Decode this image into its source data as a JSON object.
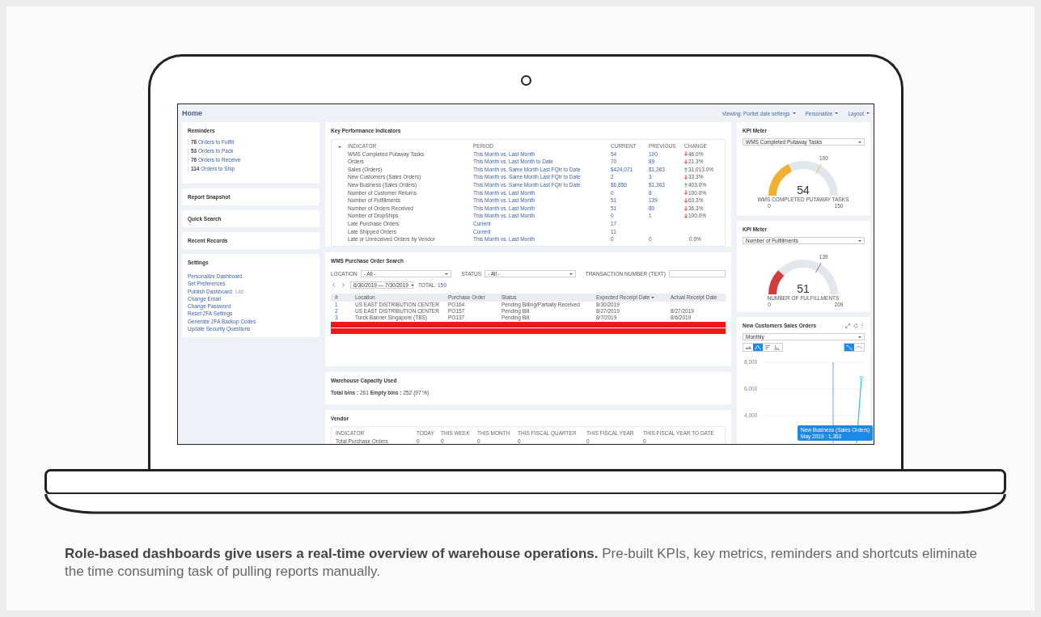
{
  "page": {
    "title": "Home",
    "header_links": [
      "Viewing: Portlet date settings",
      "Personalize",
      "Layout"
    ]
  },
  "reminders": {
    "title": "Reminders",
    "items": [
      {
        "count": "78",
        "label": "Orders to Fulfill"
      },
      {
        "count": "53",
        "label": "Orders to Pack"
      },
      {
        "count": "76",
        "label": "Orders to Receive"
      },
      {
        "count": "114",
        "label": "Orders to Ship"
      }
    ]
  },
  "collapsed_portlets": [
    "Report Snapshot",
    "Quick Search",
    "Recent Records"
  ],
  "settings": {
    "title": "Settings",
    "links": [
      {
        "label": "Personalize Dashboard"
      },
      {
        "label": "Set Preferences"
      },
      {
        "label": "Publish Dashboard",
        "badge": "List"
      },
      {
        "label": "Change Email"
      },
      {
        "label": "Change Password"
      },
      {
        "label": "Reset 2FA Settings"
      },
      {
        "label": "Generate 2FA Backup Codes"
      },
      {
        "label": "Update Security Questions"
      }
    ]
  },
  "kpi": {
    "title": "Key Performance Indicators",
    "columns": [
      "INDICATOR",
      "PERIOD",
      "CURRENT",
      "PREVIOUS",
      "CHANGE"
    ],
    "rows": [
      {
        "indicator": "WMS Completed Putaway Tasks",
        "period": "This Month vs. Last Month",
        "current": "54",
        "previous": "100",
        "change": "46.0%",
        "kind": "down"
      },
      {
        "indicator": "Orders",
        "period": "This Month vs. Last Month to Date",
        "current": "70",
        "previous": "89",
        "change": "21.3%",
        "kind": "down"
      },
      {
        "indicator": "Sales (Orders)",
        "period": "This Month vs. Same Month Last FQtr to Date",
        "current": "$424,071",
        "previous": "$1,363",
        "change": "31,013.0%",
        "kind": "up"
      },
      {
        "indicator": "New Customers (Sales Orders)",
        "period": "This Month vs. Same Month Last FQtr to Date",
        "current": "2",
        "previous": "3",
        "change": "33.3%",
        "kind": "down"
      },
      {
        "indicator": "New Business (Sales Orders)",
        "period": "This Month vs. Same Month Last FQtr to Date",
        "current": "$6,856",
        "previous": "$1,363",
        "change": "403.0%",
        "kind": "up"
      },
      {
        "indicator": "Number of Customer Returns",
        "period": "This Month vs. Last Month",
        "current": "0",
        "previous": "8",
        "change": "100.0%",
        "kind": "down"
      },
      {
        "indicator": "Number of Fulfillments",
        "period": "This Month vs. Last Month",
        "current": "51",
        "previous": "139",
        "change": "63.3%",
        "kind": "down"
      },
      {
        "indicator": "Number of Orders Received",
        "period": "This Month vs. Last Month",
        "current": "51",
        "previous": "80",
        "change": "36.3%",
        "kind": "down"
      },
      {
        "indicator": "Number of DropShips",
        "period": "This Month vs. Last Month",
        "current": "0",
        "previous": "1",
        "change": "100.0%",
        "kind": "down"
      },
      {
        "indicator": "Late Purchase Orders",
        "period": "Current",
        "current": "17"
      },
      {
        "indicator": "Late Shipped Orders",
        "period": "Current",
        "current": "11"
      },
      {
        "indicator": "Late or Unreceived Orders by Vendor",
        "period": "This Month vs. Last Month",
        "current": "0",
        "previous": "0",
        "change": "0.0%",
        "kind": "flat"
      }
    ]
  },
  "purchase_orders": {
    "title": "WMS Purchase Order Search",
    "filters": [
      {
        "label": "LOCATION",
        "kind": "select",
        "value": "- All -"
      },
      {
        "label": "STATUS",
        "kind": "select",
        "value": "- All -"
      },
      {
        "label": "TRANSACTION NUMBER (TEXT)",
        "kind": "text"
      }
    ],
    "date_range": "6/30/2019 — 7/30/2019",
    "total_label": "TOTAL:",
    "total": "159",
    "columns": [
      "#",
      "Location",
      "Purchase Order",
      "Status",
      "Expected Receipt Date",
      "Actual Receipt Date"
    ],
    "rows": [
      {
        "cells": [
          "1",
          "US EAST DISTRIBUTION CENTER",
          "PO164",
          "Pending Billing/Partially Received",
          "8/30/2019"
        ],
        "highlighted": false
      },
      {
        "cells": [
          "2",
          "US EAST DISTRIBUTION CENTER",
          "PO157",
          "Pending Bill",
          "8/27/2019",
          "8/27/2019"
        ],
        "highlighted": false
      },
      {
        "cells": [
          "3",
          "Turck Banner Singapore (TBS)",
          "PO137",
          "Pending Bill",
          "8/7/2019",
          "8/6/2019"
        ],
        "highlighted": false
      },
      {
        "cells": [],
        "highlighted": true
      },
      {
        "cells": [],
        "highlighted": true
      }
    ]
  },
  "warehouse": {
    "title": "Warehouse Capacity Used",
    "summary": "**Total bins :** 261 **Empty bins :** 252 (97 %)"
  },
  "vendor": {
    "title": "Vendor",
    "columns": [
      "INDICATOR",
      "TODAY",
      "THIS WEEK",
      "THIS MONTH",
      "THIS FISCAL QUARTER",
      "THIS FISCAL YEAR",
      "THIS FISCAL YEAR TO DATE"
    ],
    "rows": [
      {
        "cells": [
          "Total Purchase Orders",
          "0",
          "0",
          "0",
          "0",
          "0",
          "0"
        ]
      }
    ]
  },
  "meters": [
    {
      "title": "KPI Meter",
      "selected_kpi": "WMS Completed Putaway Tasks",
      "value": "54",
      "label": "WMS COMPLETED PUTAWAY TASKS",
      "min": "0",
      "max": "150",
      "target": "100",
      "level": 0.36,
      "color": "#f0b030"
    },
    {
      "title": "KPI Meter",
      "selected_kpi": "Number of Fulfillments",
      "value": "51",
      "label": "NUMBER OF FULFILLMENTS",
      "min": "0",
      "max": "209",
      "target": "139",
      "level": 0.244,
      "color": "#d23c3c"
    }
  ],
  "sales_chart": {
    "title": "New Customers Sales Orders",
    "period": "Monthly",
    "chart_types": [
      {
        "kind": "area",
        "selected": false
      },
      {
        "kind": "line",
        "selected": true
      },
      {
        "kind": "bar",
        "selected": false
      },
      {
        "kind": "column",
        "selected": false
      }
    ],
    "curve_styles": [
      {
        "kind": "smooth",
        "selected": true
      },
      {
        "kind": "straight",
        "selected": false
      }
    ],
    "y_tick_labels": [
      "8,000",
      "6,000",
      "4,000"
    ],
    "tooltip": [
      "New Business (Sales Orders)",
      "May 2019 : 1,363"
    ]
  },
  "caption": "**Role-based dashboards give users a real-time overview of warehouse operations.** Pre-built KPIs, key metrics, reminders and shortcuts eliminate the time consuming task of pulling reports manually."
}
